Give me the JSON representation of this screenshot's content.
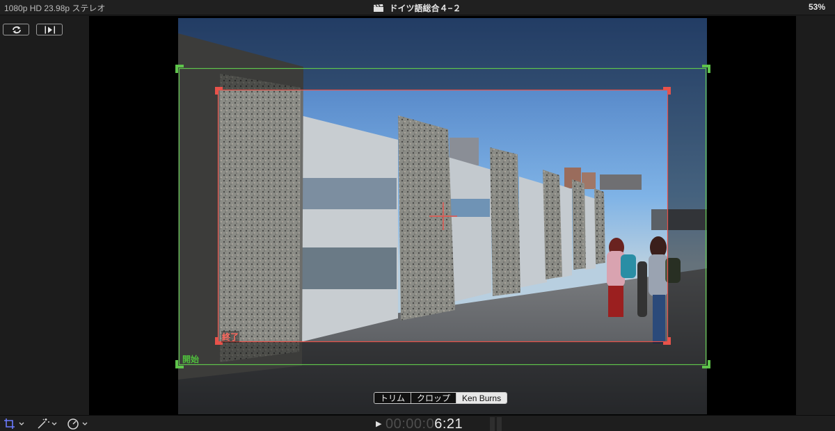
{
  "topbar": {
    "format": "1080p HD 23.98p ステレオ",
    "title": "ドイツ語総合４−２",
    "zoom": "53%"
  },
  "ken_burns": {
    "start_label": "開始",
    "end_label": "終了"
  },
  "mode_tabs": [
    {
      "label": "トリム",
      "active": false
    },
    {
      "label": "クロップ",
      "active": false
    },
    {
      "label": "Ken Burns",
      "active": true
    }
  ],
  "playback": {
    "timecode_dim": "00:00:0",
    "timecode_bright": "6:21"
  },
  "icons": {
    "swap": "swap-icon",
    "play_frame": "play-frame-icon",
    "crop": "crop-icon",
    "magic": "magic-wand-icon",
    "speed": "speedometer-icon",
    "clapper": "clapperboard-icon"
  },
  "colors": {
    "start_frame": "#5ec44b",
    "end_frame": "#e8524a",
    "crop_tool_active": "#6b7cff"
  }
}
